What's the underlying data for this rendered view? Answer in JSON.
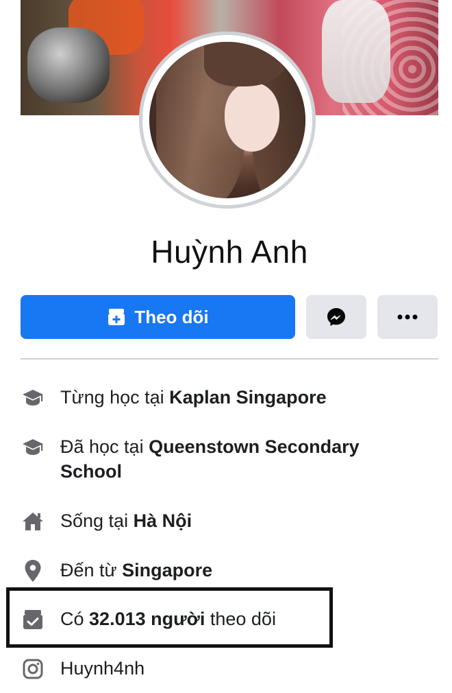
{
  "profile": {
    "name": "Huỳnh Anh"
  },
  "actions": {
    "follow_label": "Theo dõi",
    "messenger_icon": "messenger-icon",
    "more_icon": "more-dots-icon"
  },
  "colors": {
    "primary": "#1877f2",
    "secondary_button": "#e4e6eb",
    "icon_gray": "#65676b",
    "divider": "#ced0d4"
  },
  "intro": {
    "items": [
      {
        "icon": "graduation-cap-icon",
        "prefix": "Từng học tại ",
        "bold": "Kaplan Singapore",
        "suffix": ""
      },
      {
        "icon": "graduation-cap-icon",
        "prefix": "Đã học tại ",
        "bold": "Queenstown Secondary School",
        "suffix": ""
      },
      {
        "icon": "home-icon",
        "prefix": "Sống tại ",
        "bold": "Hà Nội",
        "suffix": ""
      },
      {
        "icon": "location-pin-icon",
        "prefix": "Đến từ ",
        "bold": "Singapore",
        "suffix": ""
      },
      {
        "icon": "followers-icon",
        "prefix": "Có ",
        "bold": "32.013 người",
        "suffix": " theo dõi"
      },
      {
        "icon": "instagram-icon",
        "prefix": "Huynh4nh",
        "bold": "",
        "suffix": ""
      }
    ]
  }
}
